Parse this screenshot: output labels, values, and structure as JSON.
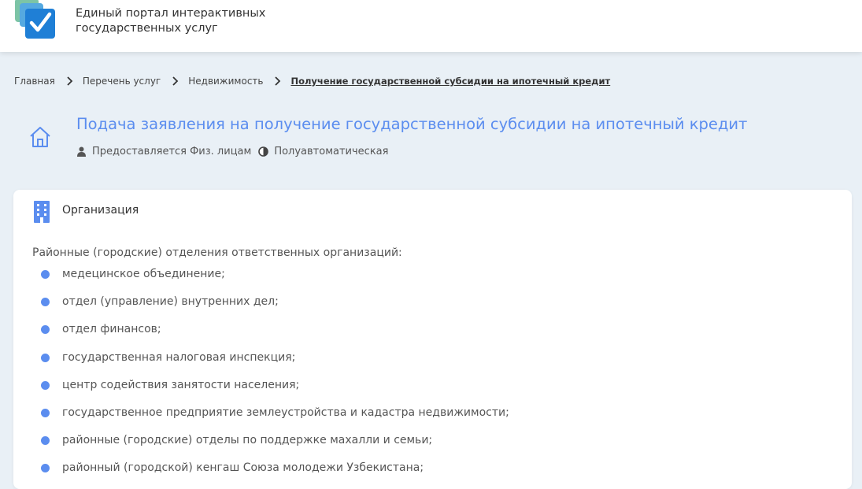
{
  "header": {
    "portal_name_line1": "Единый портал интерактивных",
    "portal_name_line2": "государственных услуг"
  },
  "breadcrumb": {
    "items": [
      "Главная",
      "Перечень услуг",
      "Недвижимость"
    ],
    "current": "Получение государственной субсидии на ипотечный кредит"
  },
  "service": {
    "title": "Подача заявления на получение государственной субсидии на ипотечный кредит",
    "provided_to": "Предоставляется Физ. лицам",
    "mode": "Полуавтоматическая"
  },
  "organization": {
    "heading": "Организация",
    "intro": "Районные (городские) отделения ответственных организаций:",
    "items": [
      "медецинское объединение;",
      "отдел (управление) внутренних дел;",
      "отдел финансов;",
      "государственная налоговая инспекция;",
      "центр содействия занятости населения;",
      "государственное предприятие землеустройства и кадастра недвижимости;",
      "районные (городские) отделы по поддержке махалли и семьи;",
      "районный (городской) кенгаш Союза молодежи Узбекистана;"
    ]
  },
  "colors": {
    "accent": "#5b8def",
    "background": "#e9f0f6",
    "card": "#ffffff"
  },
  "icons": [
    "portal-logo",
    "chevron-right-icon",
    "house-icon",
    "user-icon",
    "half-circle-icon",
    "building-icon",
    "bullet-dot"
  ]
}
